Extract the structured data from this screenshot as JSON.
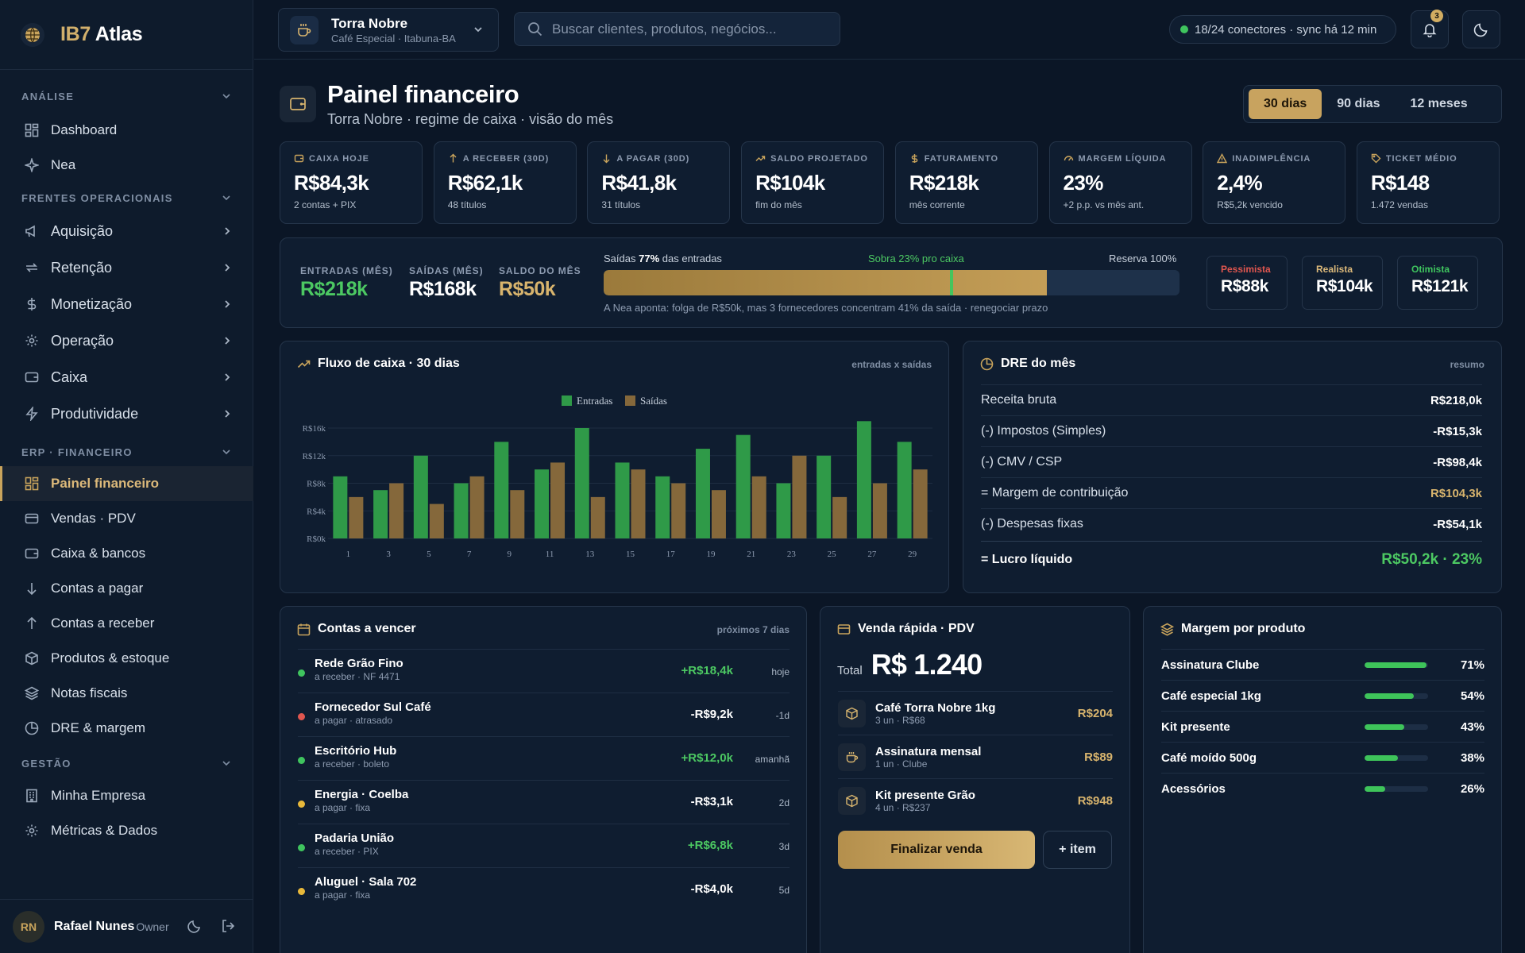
{
  "app": {
    "logo_prefix": "IB7",
    "logo_suffix": "Atlas"
  },
  "sidebar": {
    "sections": [
      {
        "label": "ANÁLISE"
      },
      {
        "label": "FRENTES OPERACIONAIS"
      },
      {
        "label": "ERP · FINANCEIRO"
      },
      {
        "label": "GESTÃO"
      }
    ],
    "analise": [
      {
        "label": "Dashboard",
        "icon": "dashboard-icon"
      },
      {
        "label": "Nea",
        "icon": "sparkle-icon"
      }
    ],
    "frentes": [
      {
        "label": "Aquisição",
        "icon": "megaphone-icon"
      },
      {
        "label": "Retenção",
        "icon": "repeat-icon"
      },
      {
        "label": "Monetização",
        "icon": "dollar-icon"
      },
      {
        "label": "Operação",
        "icon": "gear-icon"
      },
      {
        "label": "Caixa",
        "icon": "wallet-icon"
      },
      {
        "label": "Produtividade",
        "icon": "bolt-icon"
      }
    ],
    "erp": [
      {
        "label": "Painel financeiro",
        "icon": "dashboard-icon"
      },
      {
        "label": "Vendas · PDV",
        "icon": "card-icon"
      },
      {
        "label": "Caixa & bancos",
        "icon": "wallet-icon"
      },
      {
        "label": "Contas a pagar",
        "icon": "arrow-down-icon"
      },
      {
        "label": "Contas a receber",
        "icon": "arrow-up-icon"
      },
      {
        "label": "Produtos & estoque",
        "icon": "box-icon"
      },
      {
        "label": "Notas fiscais",
        "icon": "layers-icon"
      },
      {
        "label": "DRE & margem",
        "icon": "pie-icon"
      }
    ],
    "gestao": [
      {
        "label": "Minha Empresa",
        "icon": "building-icon"
      },
      {
        "label": "Métricas & Dados",
        "icon": "gear-icon"
      }
    ],
    "user": {
      "initials": "RN",
      "name": "Rafael Nunes",
      "role": "Owner"
    }
  },
  "topbar": {
    "workspace": {
      "name": "Torra Nobre",
      "sub": "Café Especial · Itabuna-BA"
    },
    "search_placeholder": "Buscar clientes, produtos, negócios...",
    "connectors": "18/24 conectores · sync há 12 min",
    "notifications": "3"
  },
  "page": {
    "title": "Painel financeiro",
    "subtitle": "Torra Nobre · regime de caixa · visão do mês",
    "periods": [
      "30 dias",
      "90 dias",
      "12 meses"
    ],
    "active_period": "30 dias"
  },
  "kpis": [
    {
      "label": "CAIXA HOJE",
      "value": "R$84,3k",
      "sub": "2 contas + PIX",
      "icon": "wallet-icon"
    },
    {
      "label": "A RECEBER (30D)",
      "value": "R$62,1k",
      "sub": "48 títulos",
      "icon": "arrow-up-icon"
    },
    {
      "label": "A PAGAR (30D)",
      "value": "R$41,8k",
      "sub": "31 títulos",
      "icon": "arrow-down-icon"
    },
    {
      "label": "SALDO PROJETADO",
      "value": "R$104k",
      "sub": "fim do mês",
      "icon": "trend-icon"
    },
    {
      "label": "FATURAMENTO",
      "value": "R$218k",
      "sub": "mês corrente",
      "icon": "dollar-icon"
    },
    {
      "label": "MARGEM LÍQUIDA",
      "value": "23%",
      "sub": "+2 p.p. vs mês ant.",
      "icon": "gauge-icon"
    },
    {
      "label": "INADIMPLÊNCIA",
      "value": "2,4%",
      "sub": "R$5,2k vencido",
      "icon": "alert-icon"
    },
    {
      "label": "TICKET MÉDIO",
      "value": "R$148",
      "sub": "1.472 vendas",
      "icon": "tag-icon"
    }
  ],
  "flow": {
    "in_label": "ENTRADAS (MÊS)",
    "in_value": "R$218k",
    "out_label": "SAÍDAS (MÊS)",
    "out_value": "R$168k",
    "bal_label": "SALDO DO MÊS",
    "bal_value": "R$50k",
    "bar_prefix": "Saídas",
    "bar_pct": "77%",
    "bar_suffix": "das entradas",
    "bar_fraction": 0.77,
    "bar_mid": "Sobra 23% pro caixa",
    "bar_right": "Reserva 100%",
    "note": "A Nea aponta: folga de R$50k, mas 3 fornecedores concentram 41% da saída · renegociar prazo",
    "scenarios": [
      {
        "label": "Pessimista",
        "value": "R$88k",
        "color": "#e0564f"
      },
      {
        "label": "Realista",
        "value": "R$104k",
        "color": "#dcb97a"
      },
      {
        "label": "Otimista",
        "value": "R$121k",
        "color": "#3fc45e"
      }
    ]
  },
  "cashflow": {
    "title": "Fluxo de caixa · 30 dias",
    "note": "entradas x saídas",
    "chart_data": {
      "type": "bar",
      "categories": [
        "1",
        "3",
        "5",
        "7",
        "9",
        "11",
        "13",
        "15",
        "17",
        "19",
        "21",
        "23",
        "25",
        "27",
        "29"
      ],
      "series": [
        {
          "name": "Entradas",
          "color": "#2f9a48",
          "values": [
            9,
            7,
            12,
            8,
            14,
            10,
            16,
            11,
            9,
            13,
            15,
            8,
            12,
            17,
            14
          ]
        },
        {
          "name": "Saídas",
          "color": "#85683b",
          "values": [
            6,
            8,
            5,
            9,
            7,
            11,
            6,
            10,
            8,
            7,
            9,
            12,
            6,
            8,
            10
          ]
        }
      ],
      "yticks": [
        "R$0k",
        "R$4k",
        "R$8k",
        "R$12k",
        "R$16k"
      ],
      "ylim": [
        0,
        16
      ],
      "legend": "top-center",
      "grid": true
    }
  },
  "dre": {
    "title": "DRE do mês",
    "note": "resumo",
    "rows": [
      {
        "label": "Receita bruta",
        "value": "R$218,0k",
        "color": "#ffffff"
      },
      {
        "label": "(-) Impostos (Simples)",
        "value": "-R$15,3k",
        "color": "#ffffff"
      },
      {
        "label": "(-) CMV / CSP",
        "value": "-R$98,4k",
        "color": "#ffffff"
      },
      {
        "label": "= Margem de contribuição",
        "value": "R$104,3k",
        "color": "#d8b46d"
      },
      {
        "label": "(-) Despesas fixas",
        "value": "-R$54,1k",
        "color": "#ffffff"
      }
    ],
    "total_label": "= Lucro líquido",
    "total_value": "R$50,2k · 23%"
  },
  "contas": {
    "title": "Contas a vencer",
    "note": "próximos 7 dias",
    "rows": [
      {
        "name": "Rede Grão Fino",
        "sub": "a receber · NF 4471",
        "value": "+R$18,4k",
        "when": "hoje",
        "dot": "#3fc45e",
        "color": "#4cc862"
      },
      {
        "name": "Fornecedor Sul Café",
        "sub": "a pagar · atrasado",
        "value": "-R$9,2k",
        "when": "-1d",
        "dot": "#e0564f",
        "color": "#ffffff"
      },
      {
        "name": "Escritório Hub",
        "sub": "a receber · boleto",
        "value": "+R$12,0k",
        "when": "amanhã",
        "dot": "#3fc45e",
        "color": "#4cc862"
      },
      {
        "name": "Energia · Coelba",
        "sub": "a pagar · fixa",
        "value": "-R$3,1k",
        "when": "2d",
        "dot": "#e8b83a",
        "color": "#ffffff"
      },
      {
        "name": "Padaria União",
        "sub": "a receber · PIX",
        "value": "+R$6,8k",
        "when": "3d",
        "dot": "#3fc45e",
        "color": "#4cc862"
      },
      {
        "name": "Aluguel · Sala 702",
        "sub": "a pagar · fixa",
        "value": "-R$4,0k",
        "when": "5d",
        "dot": "#e8b83a",
        "color": "#ffffff"
      }
    ]
  },
  "pdv": {
    "title": "Venda rápida · PDV",
    "total_label": "Total",
    "total_value": "R$ 1.240",
    "items": [
      {
        "name": "Café Torra Nobre 1kg",
        "sub": "3 un · R$68",
        "price": "R$204",
        "icon": "box-icon"
      },
      {
        "name": "Assinatura mensal",
        "sub": "1 un · Clube",
        "price": "R$89",
        "icon": "coffee-icon"
      },
      {
        "name": "Kit presente Grão",
        "sub": "4 un · R$237",
        "price": "R$948",
        "icon": "box-icon"
      }
    ],
    "finalize_label": "Finalizar venda",
    "add_label": "+ item"
  },
  "margem": {
    "title": "Margem por produto",
    "rows": [
      {
        "name": "Assinatura Clube",
        "pct": "71%",
        "value": 0.97
      },
      {
        "name": "Café especial 1kg",
        "pct": "54%",
        "value": 0.78
      },
      {
        "name": "Kit presente",
        "pct": "43%",
        "value": 0.62
      },
      {
        "name": "Café moído 500g",
        "pct": "38%",
        "value": 0.52
      },
      {
        "name": "Acessórios",
        "pct": "26%",
        "value": 0.33
      }
    ]
  }
}
